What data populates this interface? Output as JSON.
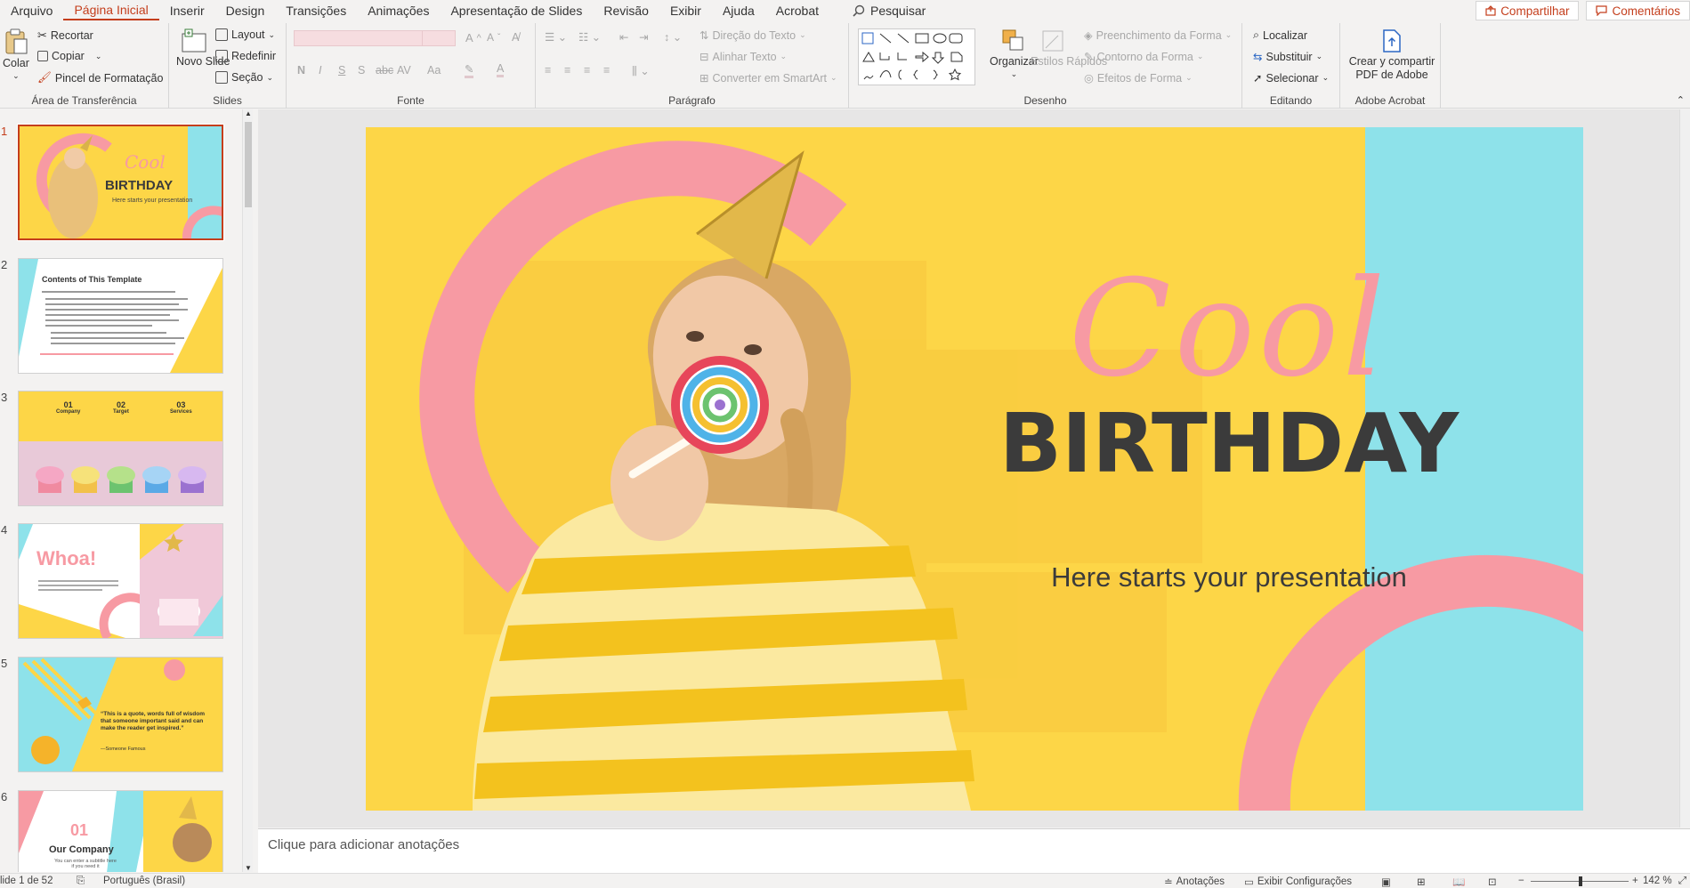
{
  "menu": {
    "items": [
      "Arquivo",
      "Página Inicial",
      "Inserir",
      "Design",
      "Transições",
      "Animações",
      "Apresentação de Slides",
      "Revisão",
      "Exibir",
      "Ajuda",
      "Acrobat"
    ],
    "active_index": 1,
    "search": "Pesquisar",
    "share": "Compartilhar",
    "comments": "Comentários"
  },
  "ribbon": {
    "clipboard": {
      "label": "Área de Transferência",
      "paste": "Colar",
      "cut": "Recortar",
      "copy": "Copiar",
      "format_painter": "Pincel de Formatação"
    },
    "slides": {
      "label": "Slides",
      "new_slide": "Novo Slide",
      "layout": "Layout",
      "reset": "Redefinir",
      "section": "Seção"
    },
    "font": {
      "label": "Fonte",
      "bold": "N",
      "italic": "I",
      "underline": "S",
      "shadow": "S",
      "strike": "abc",
      "spacing": "AV",
      "case": "Aa"
    },
    "paragraph": {
      "label": "Parágrafo",
      "text_direction": "Direção do Texto",
      "align_text": "Alinhar Texto",
      "smartart": "Converter em SmartArt"
    },
    "drawing": {
      "label": "Desenho",
      "arrange": "Organizar",
      "quick_styles": "Estilos Rápidos",
      "shape_fill": "Preenchimento da Forma",
      "shape_outline": "Contorno da Forma",
      "shape_effects": "Efeitos de Forma"
    },
    "editing": {
      "label": "Editando",
      "find": "Localizar",
      "replace": "Substituir",
      "select": "Selecionar"
    },
    "acrobat": {
      "label": "Adobe Acrobat",
      "create_share": "Crear y compartir PDF de Adobe"
    }
  },
  "thumbnails": [
    {
      "num": "1",
      "title1": "Cool",
      "title2": "BIRTHDAY",
      "sub": "Here starts your presentation"
    },
    {
      "num": "2",
      "title": "Contents of This Template"
    },
    {
      "num": "3",
      "cols": [
        {
          "n": "01",
          "t": "Company"
        },
        {
          "n": "02",
          "t": "Target"
        },
        {
          "n": "03",
          "t": "Services"
        }
      ]
    },
    {
      "num": "4",
      "title": "Whoa!"
    },
    {
      "num": "5",
      "quote": "“This is a quote, words full of wisdom that someone important said and can make the reader get inspired.”",
      "author": "—Someone Famous"
    },
    {
      "num": "6",
      "n": "01",
      "title": "Our Company",
      "sub": "You can enter a subtitle here if you need it"
    }
  ],
  "slide": {
    "title_script": "Cool",
    "title_main": "BIRTHDAY",
    "subtitle": "Here starts your presentation"
  },
  "notes_placeholder": "Clique para adicionar anotações",
  "status": {
    "slide_count": "lide 1 de 52",
    "language": "Português (Brasil)",
    "notes": "Anotações",
    "display": "Exibir Configurações",
    "zoom": "142 %"
  },
  "colors": {
    "accent": "#c43e1c",
    "yellow": "#fdd647",
    "pink": "#f79aa3",
    "cyan": "#8ee2ea",
    "dark": "#3b3b3b"
  }
}
